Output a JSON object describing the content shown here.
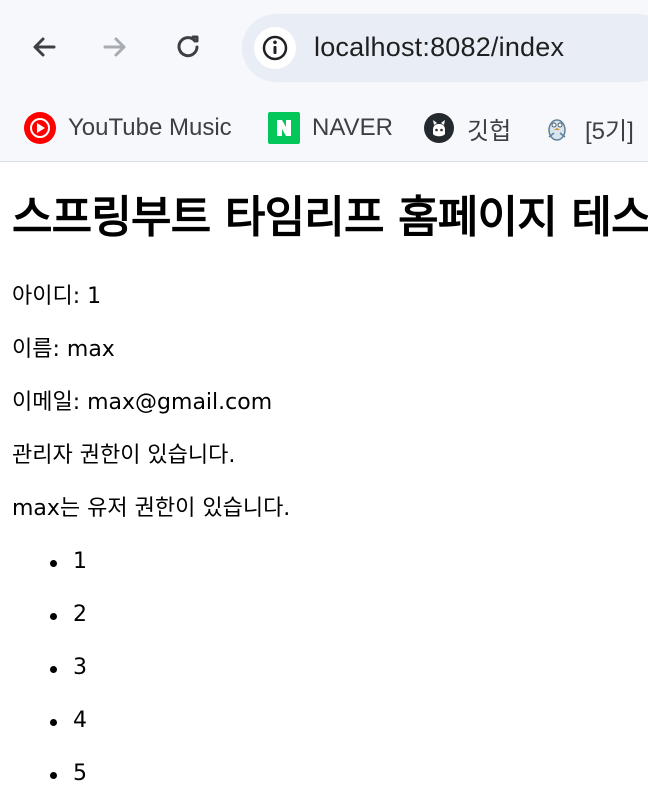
{
  "browser": {
    "url": "localhost:8082/index",
    "nav_icons": {
      "back": "back-arrow-icon",
      "forward": "forward-arrow-icon",
      "reload": "reload-icon",
      "site_info": "site-info-icon"
    },
    "bookmarks": [
      {
        "label": "YouTube Music",
        "icon": "youtube-music-icon",
        "color": "#ff0000"
      },
      {
        "label": "NAVER",
        "icon": "naver-icon",
        "color": "#03c75a"
      },
      {
        "label": "깃헙",
        "icon": "github-icon",
        "color": "#24292f"
      },
      {
        "label": "[5기]",
        "icon": "bird-icon",
        "color": "#8ba4b8"
      }
    ],
    "colors": {
      "toolbar_background": "#f6f8fc",
      "omnibox_background": "#e9eef6"
    }
  },
  "page": {
    "title": "스프링부트 타임리프 홈페이지 테스트",
    "user_id_line": "아이디: 1",
    "name_line": "이름: max",
    "email_line": "이메일: max@gmail.com",
    "admin_permission_line": "관리자 권한이 있습니다.",
    "user_permission_line": "max는 유저 권한이 있습니다.",
    "list_items": [
      "1",
      "2",
      "3",
      "4",
      "5"
    ]
  }
}
